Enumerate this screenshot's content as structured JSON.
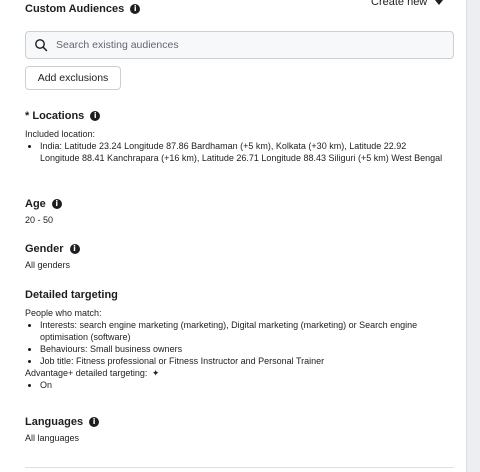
{
  "custom_audiences": {
    "title": "Custom Audiences",
    "create_new": "Create new",
    "search_placeholder": "Search existing audiences",
    "add_exclusions": "Add exclusions"
  },
  "locations": {
    "title": "Locations",
    "required_mark": "*",
    "included_label": "Included location:",
    "items": [
      "India: Latitude 23.24 Longitude 87.86 Bardhaman (+5 km), Kolkata (+30 km), Latitude 22.92 Longitude 88.41 Kanchrapara (+16 km), Latitude 26.71 Longitude 88.43 Siliguri (+5 km) West Bengal"
    ]
  },
  "age": {
    "title": "Age",
    "value": "20 - 50"
  },
  "gender": {
    "title": "Gender",
    "value": "All genders"
  },
  "detailed_targeting": {
    "title": "Detailed targeting",
    "match_label": "People who match:",
    "items": [
      "Interests: search engine marketing (marketing), Digital marketing (marketing) or Search engine optimisation (software)",
      "Behaviours: Small business owners",
      "Job title: Fitness professional or Fitness Instructor and Personal Trainer"
    ],
    "advantage_label": "Advantage+ detailed targeting:",
    "advantage_items": [
      "On"
    ]
  },
  "languages": {
    "title": "Languages",
    "value": "All languages"
  },
  "icons": {
    "info": "info-icon",
    "search": "search-icon",
    "caret": "caret-down-icon",
    "sparkle": "sparkle-icon"
  }
}
